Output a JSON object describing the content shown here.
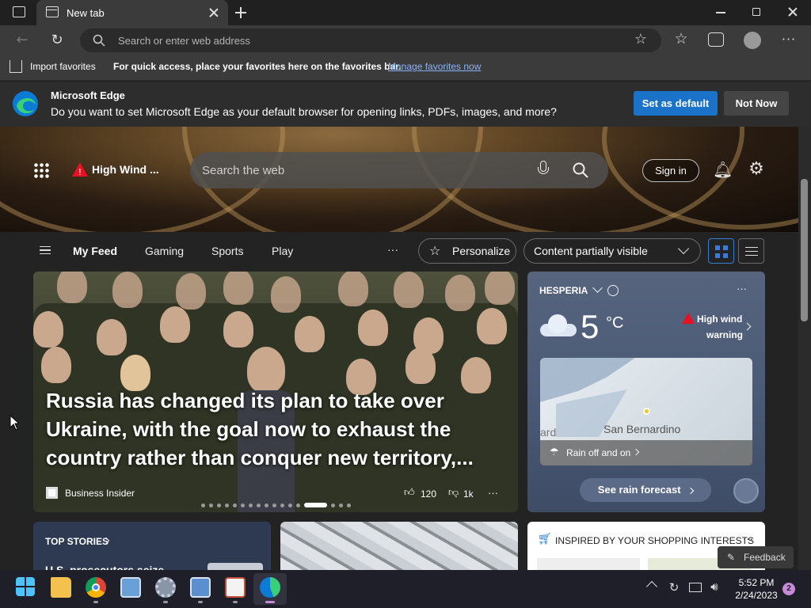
{
  "browser": {
    "tab_title": "New tab",
    "address_placeholder": "Search or enter web address"
  },
  "favorites_bar": {
    "import": "Import favorites",
    "hint": "For quick access, place your favorites here on the favorites bar.",
    "manage": "Manage favorites now"
  },
  "banner": {
    "title": "Microsoft Edge",
    "message": "Do you want to set Microsoft Edge as your default browser for opening links, PDFs, images, and more?",
    "primary": "Set as default",
    "secondary": "Not Now"
  },
  "hero": {
    "alert": "High Wind ...",
    "search_placeholder": "Search the web",
    "sign_in": "Sign in"
  },
  "feed_nav": {
    "tabs": [
      "My Feed",
      "Gaming",
      "Sports",
      "Play"
    ],
    "more": "···",
    "personalize": "Personalize",
    "content_filter": "Content partially visible"
  },
  "main_story": {
    "headline": "Russia has changed its plan to take over Ukraine, with the goal now to exhaust the country rather than conquer new territory,...",
    "source": "Business Insider",
    "likes": "120",
    "dislikes": "1k",
    "more": "···"
  },
  "weather": {
    "location": "HESPERIA",
    "temperature": "5",
    "unit": "°C",
    "alert_line1": "High wind",
    "alert_line2": "warning",
    "map_label_left": "ard",
    "map_label": "San Bernardino",
    "rain_text": "Rain off and on",
    "forecast_button": "See rain forecast",
    "more": "···"
  },
  "cards": {
    "top_stories": "TOP STORIES",
    "top_stories_snippet": "U.S. prosecutors seize",
    "shopping": "INSPIRED BY YOUR SHOPPING INTERESTS",
    "shopping_more": "···"
  },
  "feedback": "Feedback",
  "taskbar": {
    "time": "5:52 PM",
    "date": "2/24/2023",
    "notifications": "2"
  },
  "colors": {
    "accent_blue": "#1a73c9",
    "link_blue": "#8ab4f8",
    "alert_red": "#e81123",
    "active_view": "#3a7bd5"
  }
}
